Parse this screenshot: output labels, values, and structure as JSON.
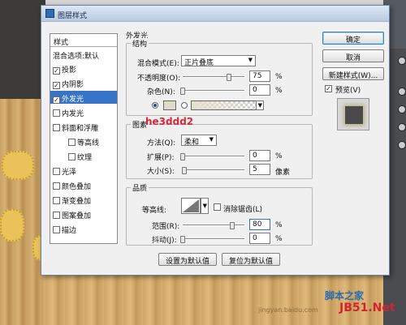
{
  "dialog": {
    "title": "图层样式"
  },
  "style_list": {
    "header": "样式",
    "blend_defaults": "混合选项:默认",
    "items": [
      {
        "label": "投影",
        "checked": true,
        "indent": false,
        "selected": false
      },
      {
        "label": "内阴影",
        "checked": true,
        "indent": false,
        "selected": false
      },
      {
        "label": "外发光",
        "checked": true,
        "indent": false,
        "selected": true
      },
      {
        "label": "内发光",
        "checked": false,
        "indent": false,
        "selected": false
      },
      {
        "label": "斜面和浮雕",
        "checked": false,
        "indent": false,
        "selected": false
      },
      {
        "label": "等高线",
        "checked": false,
        "indent": true,
        "selected": false
      },
      {
        "label": "纹理",
        "checked": false,
        "indent": true,
        "selected": false
      },
      {
        "label": "光泽",
        "checked": false,
        "indent": false,
        "selected": false
      },
      {
        "label": "颜色叠加",
        "checked": false,
        "indent": false,
        "selected": false
      },
      {
        "label": "渐变叠加",
        "checked": false,
        "indent": false,
        "selected": false
      },
      {
        "label": "图案叠加",
        "checked": false,
        "indent": false,
        "selected": false
      },
      {
        "label": "描边",
        "checked": false,
        "indent": false,
        "selected": false
      }
    ]
  },
  "outer_glow": {
    "section_title": "外发光",
    "structure": {
      "title": "结构",
      "blend_mode_label": "混合模式(E):",
      "blend_mode_value": "正片叠底",
      "opacity_label": "不透明度(O):",
      "opacity_value": "75",
      "opacity_fraction": 0.75,
      "noise_label": "杂色(N):",
      "noise_value": "0",
      "noise_fraction": 0,
      "percent": "%",
      "glow_color": "#dedcc9"
    },
    "elements": {
      "title": "图素",
      "method_label": "方法(Q):",
      "method_value": "柔和",
      "spread_label": "扩展(P):",
      "spread_value": "0",
      "spread_fraction": 0,
      "size_label": "大小(S):",
      "size_value": "5",
      "size_fraction": 0.02,
      "percent": "%",
      "px": "像素"
    },
    "quality": {
      "title": "品质",
      "contour_label": "等高线:",
      "antialias_label": "消除锯齿(L)",
      "range_label": "范围(R):",
      "range_value": "80",
      "range_fraction": 0.8,
      "jitter_label": "抖动(J):",
      "jitter_value": "0",
      "jitter_fraction": 0,
      "percent": "%"
    },
    "make_default": "设置为默认值",
    "reset_default": "复位为默认值"
  },
  "buttons": {
    "ok": "确定",
    "cancel": "取消",
    "new_style": "新建样式(W)...",
    "preview_label": "预览(V)"
  },
  "watermark": "he3ddd2",
  "site_watermark": {
    "line1": "脚本之家",
    "line2": "JB51.Net",
    "small": "jingyan.baidu.com"
  }
}
